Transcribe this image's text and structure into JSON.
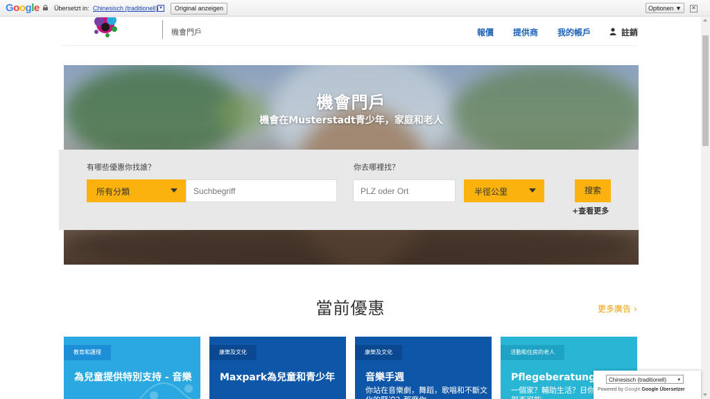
{
  "translate_bar": {
    "logo": "Google",
    "translated_label": "Übersetzt in:",
    "language": "Chinesisch (traditionell)",
    "original_button": "Original anzeigen",
    "options_button": "Optionen ▼",
    "close_symbol": "✕"
  },
  "header": {
    "portal_label": "機會門戶",
    "nav": [
      "報價",
      "提供商",
      "我的帳戶"
    ],
    "logout": "註銷"
  },
  "hero": {
    "title": "機會門戶",
    "subtitle": "機會在Musterstadt青少年，家庭和老人"
  },
  "search": {
    "what_label": "有哪些優惠你找誰？",
    "where_label": "你去哪裡找？",
    "category_value": "所有分類",
    "keyword_placeholder": "Suchbegriff",
    "location_placeholder": "PLZ oder Ort",
    "radius_value": "半徑公里",
    "button": "搜索",
    "more": "+查看更多"
  },
  "offers": {
    "title": "當前優惠",
    "more_ads": "更多廣告 ›",
    "cards": [
      {
        "tag": "教育和護理",
        "title": "為兒童提供特別支持 - 音樂",
        "desc": ""
      },
      {
        "tag": "康樂及文化",
        "title": "Maxpark為兒童和青少年",
        "desc": ""
      },
      {
        "tag": "康樂及文化",
        "title": "音樂手週",
        "desc": "你站在音樂劇，舞蹈，歌唱和不斷文化的緊迫？那麼你"
      },
      {
        "tag": "活動和住房的老人",
        "title": "Pflegeberatung",
        "desc": "一個家？輔助生活？日你想何解釋你與否可能"
      }
    ]
  },
  "gt_widget": {
    "language": "Chinesisch (traditionell)",
    "powered_by": "Powered by",
    "google": "Google",
    "translator": "Google Übersetzer"
  },
  "colors": {
    "accent_yellow": "#fbb20c",
    "nav_blue": "#1c63b7",
    "card1": "#29a9e0",
    "card2": "#0e56a8",
    "card3": "#0e56a8",
    "card4": "#29b5d4"
  }
}
